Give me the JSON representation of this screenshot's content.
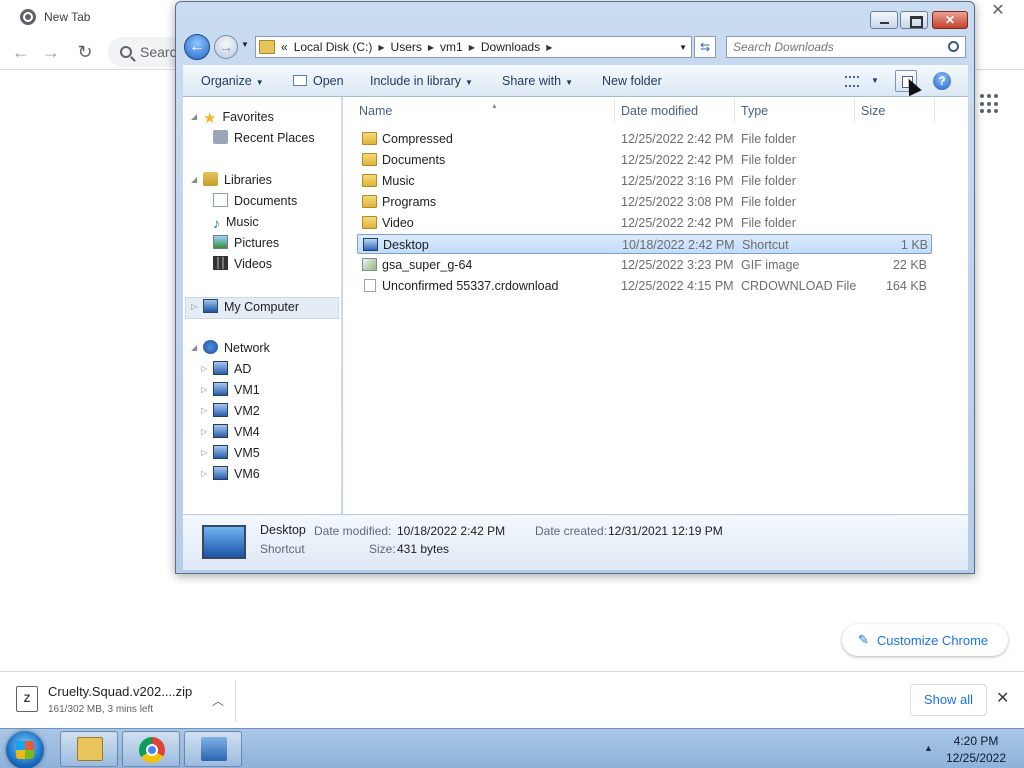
{
  "chrome": {
    "tab_title": "New Tab",
    "omnibox_placeholder": "Searc",
    "customize_label": "Customize Chrome",
    "close_glyph": "✕",
    "back_glyph": "←",
    "forward_glyph": "→",
    "reload_glyph": "↻",
    "pencil_glyph": "✎"
  },
  "download": {
    "icon_letter": "Z",
    "file_name": "Cruelty.Squad.v202....zip",
    "status": "161/302 MB, 3 mins left",
    "chevron": "︿",
    "show_all": "Show all",
    "close_glyph": "✕"
  },
  "explorer": {
    "close_glyph": "✕",
    "back_glyph": "←",
    "forward_glyph": "→",
    "breadcrumb": [
      "Local Disk (C:)",
      "Users",
      "vm1",
      "Downloads"
    ],
    "breadcrumb_prefix": "«",
    "search_placeholder": "Search Downloads",
    "commands": {
      "organize": "Organize",
      "open": "Open",
      "include": "Include in library",
      "share": "Share with",
      "new_folder": "New folder"
    },
    "help_glyph": "?",
    "nav": {
      "favorites": "Favorites",
      "recent_places": "Recent Places",
      "libraries": "Libraries",
      "documents": "Documents",
      "music": "Music",
      "pictures": "Pictures",
      "videos": "Videos",
      "my_computer": "My Computer",
      "network": "Network",
      "hosts": [
        "AD",
        "VM1",
        "VM2",
        "VM4",
        "VM5",
        "VM6"
      ]
    },
    "columns": {
      "name": "Name",
      "date": "Date modified",
      "type": "Type",
      "size": "Size"
    },
    "files": [
      {
        "name": "Compressed",
        "date": "12/25/2022 2:42 PM",
        "type": "File folder",
        "size": "",
        "icon": "folder-icon"
      },
      {
        "name": "Documents",
        "date": "12/25/2022 2:42 PM",
        "type": "File folder",
        "size": "",
        "icon": "folder-icon"
      },
      {
        "name": "Music",
        "date": "12/25/2022 3:16 PM",
        "type": "File folder",
        "size": "",
        "icon": "folder-icon"
      },
      {
        "name": "Programs",
        "date": "12/25/2022 3:08 PM",
        "type": "File folder",
        "size": "",
        "icon": "folder-icon"
      },
      {
        "name": "Video",
        "date": "12/25/2022 2:42 PM",
        "type": "File folder",
        "size": "",
        "icon": "folder-icon"
      },
      {
        "name": "Desktop",
        "date": "10/18/2022 2:42 PM",
        "type": "Shortcut",
        "size": "1 KB",
        "icon": "shortcut-icon"
      },
      {
        "name": "gsa_super_g-64",
        "date": "12/25/2022 3:23 PM",
        "type": "GIF image",
        "size": "22 KB",
        "icon": "gif-image-icon"
      },
      {
        "name": "Unconfirmed 55337.crdownload",
        "date": "12/25/2022 4:15 PM",
        "type": "CRDOWNLOAD File",
        "size": "164 KB",
        "icon": "file-icon"
      }
    ],
    "details": {
      "name": "Desktop",
      "type": "Shortcut",
      "modified_label": "Date modified:",
      "modified_value": "10/18/2022 2:42 PM",
      "created_label": "Date created:",
      "created_value": "12/31/2021 12:19 PM",
      "size_label": "Size:",
      "size_value": "431 bytes"
    }
  },
  "taskbar": {
    "tray_arrow": "▲",
    "time": "4:20 PM",
    "date": "12/25/2022"
  }
}
